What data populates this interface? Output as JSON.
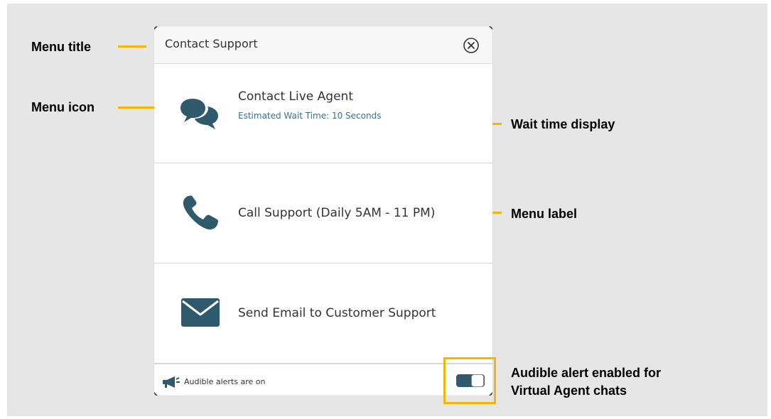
{
  "callouts": {
    "menu_title": "Menu title",
    "menu_icon": "Menu icon",
    "wait_time_display": "Wait time display",
    "menu_label": "Menu label",
    "audible_alert_line1": "Audible alert enabled for",
    "audible_alert_line2": "Virtual Agent chats"
  },
  "panel": {
    "title": "Contact Support",
    "items": [
      {
        "label": "Contact Live Agent",
        "sublabel": "Estimated Wait Time: 10 Seconds",
        "icon": "chat-bubbles-icon"
      },
      {
        "label": "Call Support (Daily 5AM - 11 PM)",
        "icon": "phone-icon"
      },
      {
        "label": "Send Email to Customer Support",
        "icon": "envelope-icon"
      }
    ],
    "footer": {
      "text": "Audible alerts are on",
      "icon": "megaphone-icon",
      "toggle_on": true
    }
  },
  "colors": {
    "icon": "#2f5a6b",
    "accent_callout": "#f2b705",
    "sublabel": "#3b7288",
    "background": "#e6e6e6"
  }
}
